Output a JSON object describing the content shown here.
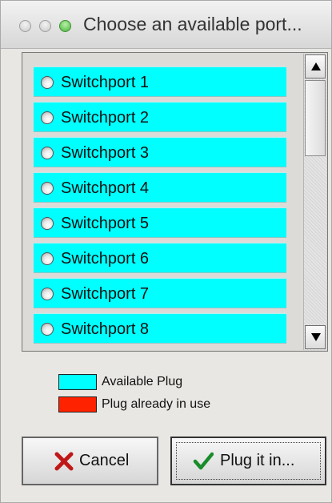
{
  "window": {
    "title": "Choose an available port..."
  },
  "ports": [
    {
      "label": "Switchport 1",
      "status": "available",
      "selected": false
    },
    {
      "label": "Switchport 2",
      "status": "available",
      "selected": false
    },
    {
      "label": "Switchport 3",
      "status": "available",
      "selected": false
    },
    {
      "label": "Switchport 4",
      "status": "available",
      "selected": false
    },
    {
      "label": "Switchport 5",
      "status": "available",
      "selected": false
    },
    {
      "label": "Switchport 6",
      "status": "available",
      "selected": false
    },
    {
      "label": "Switchport 7",
      "status": "available",
      "selected": false
    },
    {
      "label": "Switchport 8",
      "status": "available",
      "selected": false
    }
  ],
  "scrollbar": {
    "position_fraction": 0.0,
    "visible_fraction": 0.3
  },
  "legend": {
    "items": [
      {
        "label": "Available Plug",
        "color": "#00ffff"
      },
      {
        "label": "Plug already in use",
        "color": "#ff2200"
      }
    ]
  },
  "buttons": {
    "cancel": {
      "label": "Cancel",
      "icon": "red-x-icon"
    },
    "plug": {
      "label": "Plug it in...",
      "icon": "green-checkmark-icon"
    }
  }
}
